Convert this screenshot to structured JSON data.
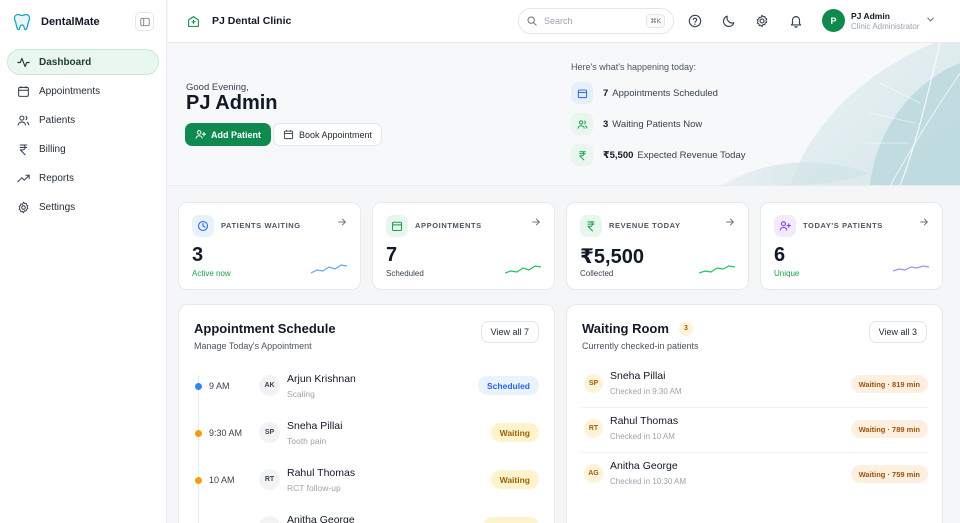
{
  "app": {
    "name": "DentalMate"
  },
  "sidebar": {
    "items": [
      {
        "label": "Dashboard",
        "icon": "activity-icon",
        "active": true
      },
      {
        "label": "Appointments",
        "icon": "calendar-icon"
      },
      {
        "label": "Patients",
        "icon": "users-icon"
      },
      {
        "label": "Billing",
        "icon": "rupee-icon"
      },
      {
        "label": "Reports",
        "icon": "trending-up-icon"
      },
      {
        "label": "Settings",
        "icon": "gear-icon"
      }
    ]
  },
  "topbar": {
    "clinic": "PJ Dental Clinic",
    "search_placeholder": "Search",
    "search_shortcut": "⌘K",
    "user": {
      "initial": "P",
      "name": "PJ Admin",
      "role": "Clinic Administrator"
    }
  },
  "hero": {
    "greeting": "Good Evening,",
    "name": "PJ Admin",
    "add_patient": "Add Patient",
    "book_appointment": "Book Appointment",
    "summary_title": "Here's what's happening today:",
    "highlights": [
      {
        "value": "7",
        "text": "Appointments Scheduled"
      },
      {
        "value": "3",
        "text": "Waiting Patients Now"
      },
      {
        "value": "₹5,500",
        "text": "Expected Revenue Today"
      }
    ]
  },
  "stats": [
    {
      "label": "PATIENTS WAITING",
      "value": "3",
      "sub": "Active now",
      "color": "#2563eb"
    },
    {
      "label": "APPOINTMENTS",
      "value": "7",
      "sub": "Scheduled",
      "color": "#16a34a"
    },
    {
      "label": "REVENUE TODAY",
      "value": "₹5,500",
      "sub": "Collected",
      "color": "#16a34a"
    },
    {
      "label": "TODAY'S PATIENTS",
      "value": "6",
      "sub": "Unique",
      "color": "#7c3aed"
    }
  ],
  "schedule": {
    "title": "Appointment Schedule",
    "subtitle": "Manage Today's Appointment",
    "view_all": "View all 7",
    "items": [
      {
        "time": "9 AM",
        "initials": "AK",
        "name": "Arjun Krishnan",
        "desc": "Scaling",
        "status": "Scheduled"
      },
      {
        "time": "9:30 AM",
        "initials": "SP",
        "name": "Sneha Pillai",
        "desc": "Tooth pain",
        "status": "Waiting"
      },
      {
        "time": "10 AM",
        "initials": "RT",
        "name": "Rahul Thomas",
        "desc": "RCT follow-up",
        "status": "Waiting"
      },
      {
        "time": "",
        "initials": "AG",
        "name": "Anitha George",
        "desc": "",
        "status": ""
      }
    ]
  },
  "waiting": {
    "title": "Waiting Room",
    "count": "3",
    "subtitle": "Currently checked-in patients",
    "view_all": "View all 3",
    "items": [
      {
        "initials": "SP",
        "name": "Sneha Pillai",
        "checked": "Checked in 9:30 AM",
        "badge": "Waiting · 819 min"
      },
      {
        "initials": "RT",
        "name": "Rahul Thomas",
        "checked": "Checked in 10 AM",
        "badge": "Waiting · 789 min"
      },
      {
        "initials": "AG",
        "name": "Anitha George",
        "checked": "Checked in 10:30 AM",
        "badge": "Waiting · 759 min"
      }
    ]
  }
}
